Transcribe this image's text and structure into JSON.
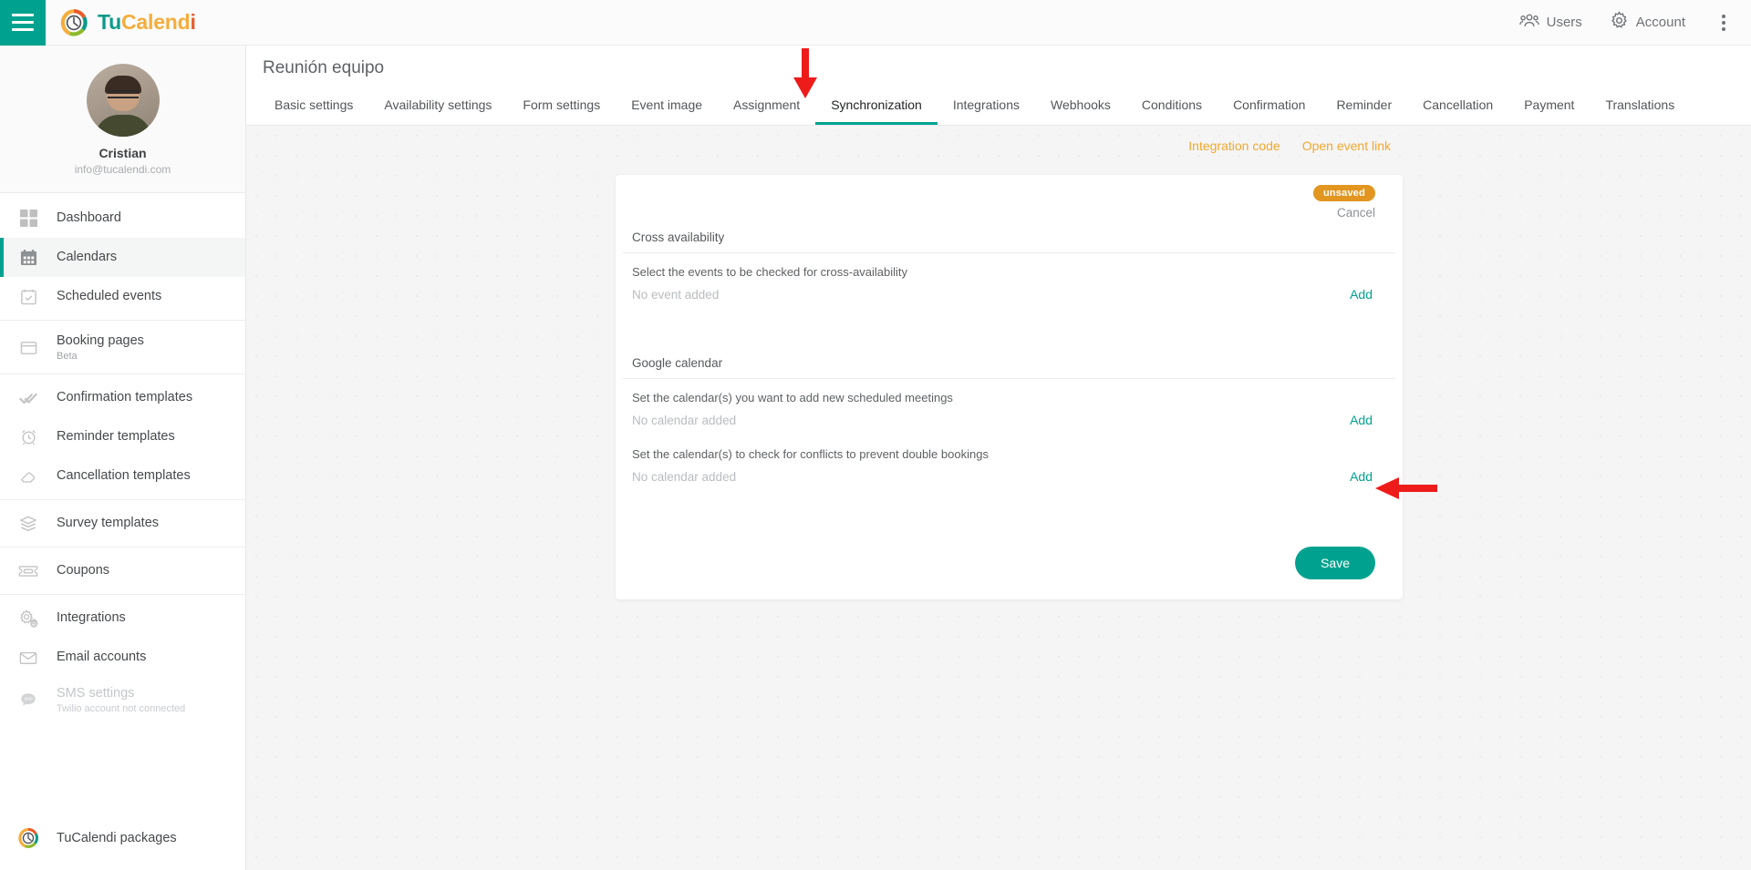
{
  "topbar": {
    "menu_icon": "hamburger-icon",
    "brand": {
      "part1": "Tu",
      "part2": "Calend",
      "part3": "i",
      "logo_icon": "tucalendi-logo-icon"
    },
    "users_label": "Users",
    "users_icon": "users-icon",
    "account_label": "Account",
    "account_icon": "gear-icon",
    "overflow_icon": "kebab-menu-icon"
  },
  "sidebar": {
    "profile": {
      "name": "Cristian",
      "email": "info@tucalendi.com",
      "avatar_icon": "avatar"
    },
    "groups": [
      {
        "items": [
          {
            "label": "Dashboard",
            "icon": "dashboard-grid-icon",
            "active": false
          },
          {
            "label": "Calendars",
            "icon": "calendar-icon",
            "active": true
          },
          {
            "label": "Scheduled events",
            "icon": "calendar-check-icon",
            "active": false
          }
        ]
      },
      {
        "items": [
          {
            "label": "Booking pages",
            "sub": "Beta",
            "icon": "browser-window-icon",
            "active": false
          }
        ]
      },
      {
        "items": [
          {
            "label": "Confirmation templates",
            "icon": "double-check-icon",
            "active": false
          },
          {
            "label": "Reminder templates",
            "icon": "alarm-clock-icon",
            "active": false
          },
          {
            "label": "Cancellation templates",
            "icon": "eraser-icon",
            "active": false
          }
        ]
      },
      {
        "items": [
          {
            "label": "Survey templates",
            "icon": "layers-icon",
            "active": false
          }
        ]
      },
      {
        "items": [
          {
            "label": "Coupons",
            "icon": "ticket-icon",
            "active": false
          }
        ]
      },
      {
        "items": [
          {
            "label": "Integrations",
            "icon": "gears-icon",
            "active": false
          },
          {
            "label": "Email accounts",
            "icon": "envelope-icon",
            "active": false
          },
          {
            "label": "SMS settings",
            "sub": "Twilio account not connected",
            "icon": "sms-bubble-icon",
            "active": false,
            "disabled": true
          }
        ]
      }
    ],
    "bottom": {
      "label": "TuCalendi packages",
      "icon": "tucalendi-logo-icon"
    }
  },
  "main": {
    "page_title": "Reunión equipo",
    "tabs": [
      {
        "label": "Basic settings",
        "active": false
      },
      {
        "label": "Availability settings",
        "active": false
      },
      {
        "label": "Form settings",
        "active": false
      },
      {
        "label": "Event image",
        "active": false
      },
      {
        "label": "Assignment",
        "active": false
      },
      {
        "label": "Synchronization",
        "active": true
      },
      {
        "label": "Integrations",
        "active": false
      },
      {
        "label": "Webhooks",
        "active": false
      },
      {
        "label": "Conditions",
        "active": false
      },
      {
        "label": "Confirmation",
        "active": false
      },
      {
        "label": "Reminder",
        "active": false
      },
      {
        "label": "Cancellation",
        "active": false
      },
      {
        "label": "Payment",
        "active": false
      },
      {
        "label": "Translations",
        "active": false
      }
    ],
    "links": [
      {
        "label": "Integration code"
      },
      {
        "label": "Open event link"
      }
    ]
  },
  "card": {
    "badge": "unsaved",
    "cancel_label": "Cancel",
    "sections": [
      {
        "title": "Cross availability",
        "rows": [
          {
            "desc": "Select the events to be checked for cross-availability",
            "value": "No event added",
            "add_label": "Add"
          }
        ]
      },
      {
        "title": "Google calendar",
        "rows": [
          {
            "desc": "Set the calendar(s) you want to add new scheduled meetings",
            "value": "No calendar added",
            "add_label": "Add"
          },
          {
            "desc": "Set the calendar(s) to check for conflicts to prevent double bookings",
            "value": "No calendar added",
            "add_label": "Add"
          }
        ]
      }
    ],
    "save_label": "Save"
  },
  "annotations": {
    "arrow_down": "red-down-arrow pointing at Synchronization tab",
    "arrow_left": "red-left-arrow pointing at Add link",
    "color": "#ee1b1b"
  },
  "colors": {
    "accent_teal": "#00a28f",
    "link_orange": "#f0a830",
    "badge_orange": "#e2951f",
    "annotation_red": "#ee1b1b"
  }
}
